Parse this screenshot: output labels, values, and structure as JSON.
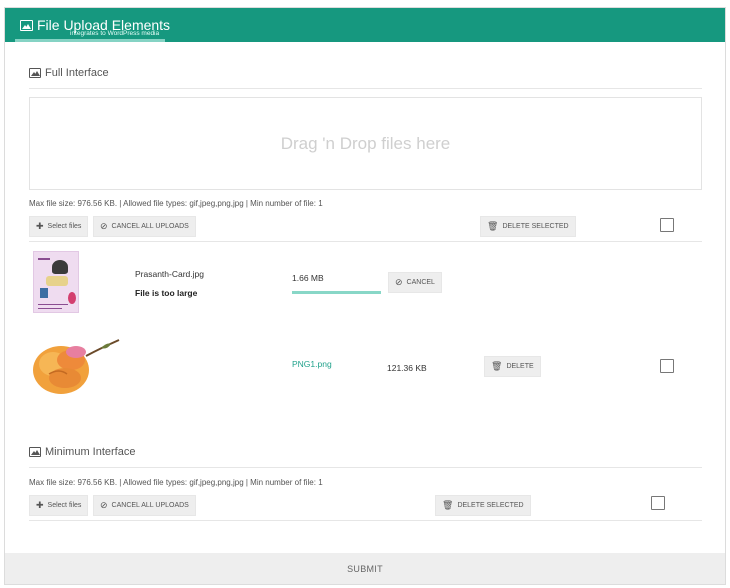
{
  "header": {
    "title": "File Upload Elements",
    "subtitle": "integrates to WordPress media",
    "accent_color": "#16987f"
  },
  "full_interface": {
    "heading": "Full Interface",
    "dropzone_text": "Drag 'n Drop files here",
    "info_text": "Max file size: 976.56 KB. | Allowed file types: gif,jpeg,png,jpg | Min number of file: 1",
    "select_files_label": "Select files",
    "cancel_all_label": "CANCEL ALL UPLOADS",
    "delete_selected_label": "DELETE SELECTED",
    "files": [
      {
        "name": "Prasanth-Card.jpg",
        "error": "File is too large",
        "size": "1.66 MB",
        "progress": 1.0,
        "action_label": "CANCEL",
        "action_icon": "cancel-circle-icon"
      },
      {
        "name": "PNG1.png",
        "size": "121.36 KB",
        "action_label": "DELETE",
        "action_icon": "trash-icon"
      }
    ]
  },
  "minimum_interface": {
    "heading": "Minimum Interface",
    "info_text": "Max file size: 976.56 KB. | Allowed file types: gif,jpeg,png,jpg | Min number of file: 1",
    "select_files_label": "Select files",
    "cancel_all_label": "CANCEL ALL UPLOADS",
    "delete_selected_label": "DELETE SELECTED"
  },
  "submit_label": "SUBMIT"
}
